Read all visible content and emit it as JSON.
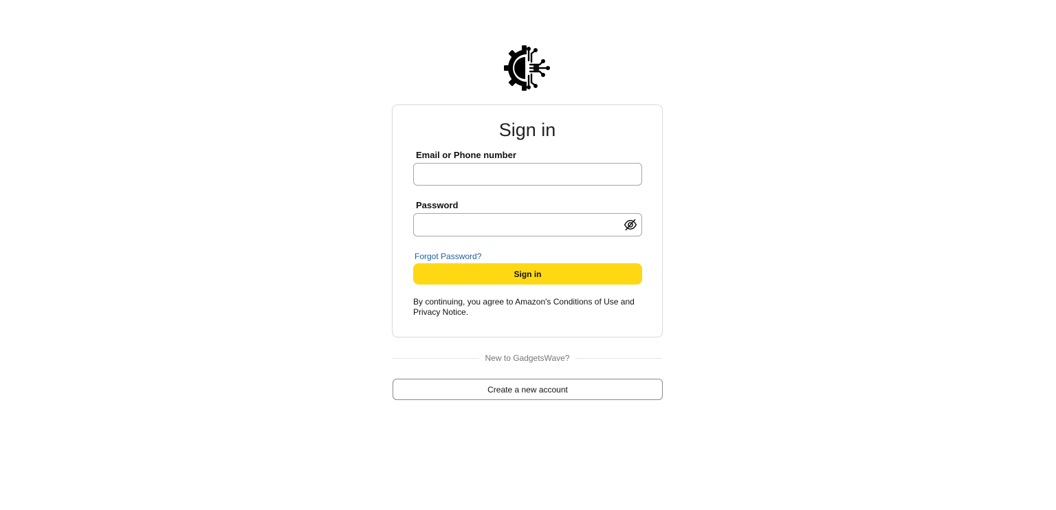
{
  "header": {
    "logo_icon": "circuit-gear-logo-icon"
  },
  "signin": {
    "title": "Sign in",
    "email_label": "Email or Phone number",
    "email_value": "",
    "password_label": "Password",
    "password_value": "",
    "password_toggle_icon": "eye-slash-icon",
    "forgot_password": "Forgot Password?",
    "submit_label": "Sign in",
    "legal_text": "By continuing, you agree to Amazon's Conditions of Use and Privacy Notice."
  },
  "footer": {
    "divider_text": "New to GadgetsWave?",
    "create_account_label": "Create a new account"
  },
  "colors": {
    "primary_button": "#ffd814",
    "link": "#1f5f9f",
    "border": "#d5d9d9"
  }
}
